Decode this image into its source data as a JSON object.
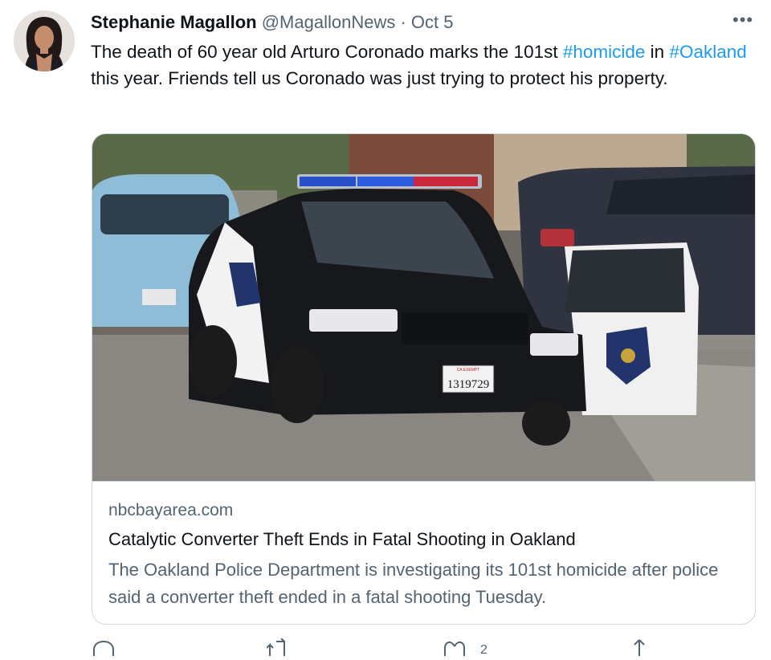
{
  "tweet": {
    "author_name": "Stephanie Magallon",
    "handle": "@MagallonNews",
    "separator": "·",
    "date": "Oct 5",
    "more_label": "•••",
    "text_parts": {
      "p1": "The death of 60 year old Arturo Coronado marks the 101st ",
      "tag1": "#homicide",
      "p2": " in ",
      "tag2": "#Oakland",
      "p3": " this year. Friends tell us Coronado was just trying to protect his property."
    }
  },
  "card": {
    "image_label": "Oakland police car",
    "plate_text": "1319729",
    "plate_top_text": "CA EXEMPT",
    "domain": "nbcbayarea.com",
    "title": "Catalytic Converter Theft Ends in Fatal Shooting in Oakland",
    "description": "The Oakland Police Department is investigating its 101st homicide after police said a converter theft ended in a fatal shooting Tuesday."
  },
  "actions": {
    "reply_icon": "reply-icon",
    "retweet_icon": "retweet-icon",
    "like_icon": "like-icon",
    "like_count": "2",
    "share_icon": "share-icon"
  },
  "colors": {
    "link": "#1d9bf0",
    "secondary_text": "#536471",
    "border": "#cfd9de"
  }
}
